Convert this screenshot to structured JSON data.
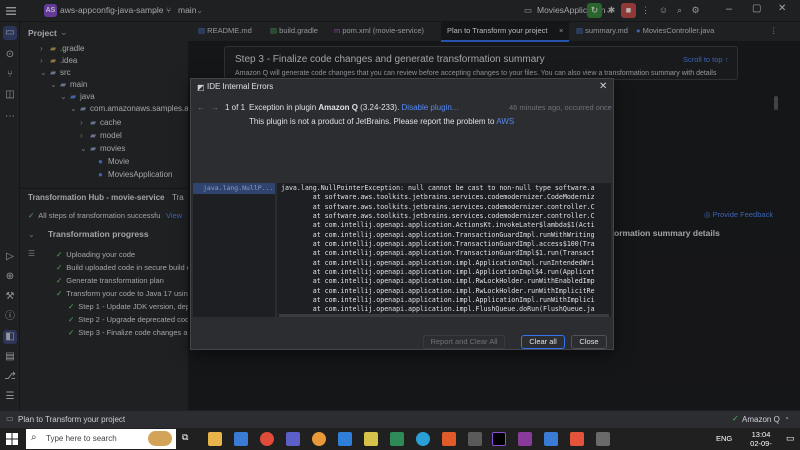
{
  "titlebar": {
    "project_initials": "AS",
    "project_name": "aws-appconfig-java-sample",
    "branch": "main",
    "run_config": "MoviesApplication"
  },
  "project_panel": {
    "title": "Project",
    "tree": [
      {
        "label": ".gradle"
      },
      {
        "label": ".idea"
      },
      {
        "label": "src"
      },
      {
        "label": "main"
      },
      {
        "label": "java"
      },
      {
        "label": "com.amazonaws.samples.app"
      },
      {
        "label": "cache"
      },
      {
        "label": "model"
      },
      {
        "label": "movies"
      },
      {
        "label": "Movie"
      },
      {
        "label": "MoviesApplication"
      }
    ]
  },
  "hub": {
    "title": "Transformation Hub - movie-service",
    "tab2": "Tra",
    "banner": "All steps of transformation successfu",
    "banner_link": "View",
    "progress_title": "Transformation progress",
    "steps": [
      "Uploading your code",
      "Build uploaded code in secure build e",
      "Generate transformation plan",
      "Transform your code to Java 17 usin",
      "Step 1 - Update JDK version, dep",
      "Step 2 - Upgrade deprecated cod",
      "Step 3 - Finalize code changes ar"
    ]
  },
  "editor": {
    "tabs": [
      "README.md",
      "build.gradle",
      "pom.xml (movie-service)",
      "Plan to Transform your project",
      "summary.md",
      "MoviesController.java"
    ],
    "doc_heading": "Step 3 - Finalize code changes and generate transformation summary",
    "scroll_top": "Scroll to top",
    "doc_body": "Amazon Q will generate code changes that you can review before accepting changes to your files. You can also view a transformation summary with details",
    "provide_feedback": "Provide Feedback",
    "summary_details": "ormation summary details"
  },
  "dialog": {
    "title": "IDE Internal Errors",
    "counter": "1 of 1",
    "error_prefix": "Exception in plugin ",
    "plugin_name": "Amazon Q",
    "plugin_version": " (3.24-233). ",
    "disable_link": "Disable plugin...",
    "time_ago": "46 minutes ago, occurred once",
    "notice_text": "This plugin is not a product of JetBrains. Please report the problem to ",
    "notice_link": "AWS",
    "list_item": "java.lang.NullP...",
    "stacktrace": [
      "java.lang.NullPointerException: null cannot be cast to non-null type software.a",
      "        at software.aws.toolkits.jetbrains.services.codemodernizer.CodeModerniz",
      "        at software.aws.toolkits.jetbrains.services.codemodernizer.controller.C",
      "        at software.aws.toolkits.jetbrains.services.codemodernizer.controller.C",
      "        at com.intellij.openapi.application.ActionsKt.invokeLater$lambda$1(Acti",
      "        at com.intellij.openapi.application.TransactionGuardImpl.runWithWriting",
      "        at com.intellij.openapi.application.TransactionGuardImpl.access$100(Tra",
      "        at com.intellij.openapi.application.TransactionGuardImpl$1.run(Transact",
      "        at com.intellij.openapi.application.impl.ApplicationImpl.runIntendedWri",
      "        at com.intellij.openapi.application.impl.ApplicationImpl$4.run(Applicat",
      "        at com.intellij.openapi.application.impl.RwLockHolder.runWithEnabledImp",
      "        at com.intellij.openapi.application.impl.RwLockHolder.runWithImplicitRe",
      "        at com.intellij.openapi.application.impl.ApplicationImpl.runWithImplici",
      "        at com.intellij.openapi.application.impl.FlushQueue.doRun(FlushQueue.ja",
      "        at com.intellij.openapi.application.impl.FlushQueue.runNextEvent(FlushQ"
    ],
    "report_button": "Report and Clear All",
    "clear_all_button": "Clear all",
    "close_button": "Close"
  },
  "statusbar": {
    "left": "Plan to Transform your project",
    "right": "Amazon Q"
  },
  "taskbar": {
    "search_placeholder": "Type here to search",
    "time": "13:04",
    "date": "02-09-2024",
    "lang": "ENG"
  },
  "colors": {
    "accent": "#3574f0",
    "link": "#548af7",
    "success": "#5fb865",
    "panel": "#2b2d30",
    "editor": "#1e1f22"
  }
}
